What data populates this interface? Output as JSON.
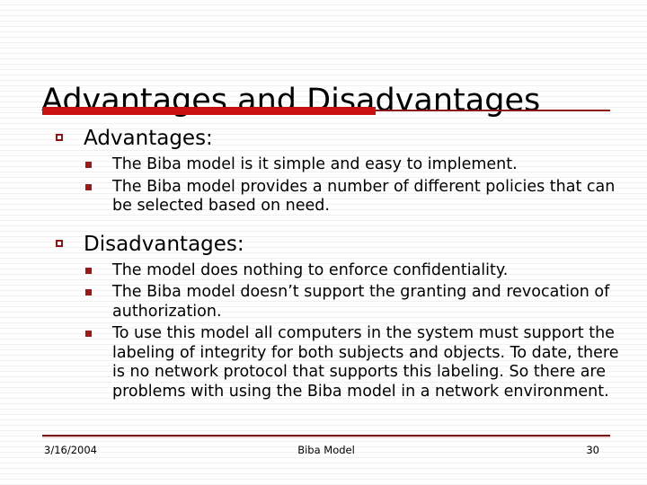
{
  "slide": {
    "title": "Advantages and Disadvantages",
    "accent_color": "#cc1111",
    "rule_color": "#8c1616",
    "bullet_hollow_color": "#8c1616",
    "bullet_solid_color": "#a01818",
    "background_color": "#ffffff",
    "text_color": "#000000",
    "bullet_hollow_icon": "hollow-square-bullet",
    "bullet_solid_icon": "filled-square-bullet",
    "sections": [
      {
        "heading": "Advantages:",
        "items": [
          "The Biba model is it simple and easy to implement.",
          "The Biba model provides a number of different policies that can be selected based on need."
        ]
      },
      {
        "heading": "Disadvantages:",
        "items": [
          "The model does nothing to enforce confidentiality.",
          "The Biba model doesn’t support the granting and revocation of authorization.",
          "To use this model all computers in the system must support the labeling of  integrity for both subjects and objects.  To date, there is no network protocol that supports this labeling.  So there are problems with using the Biba model in a network environment."
        ]
      }
    ]
  },
  "footer": {
    "date": "3/16/2004",
    "center": "Biba Model",
    "page_number": "30"
  }
}
